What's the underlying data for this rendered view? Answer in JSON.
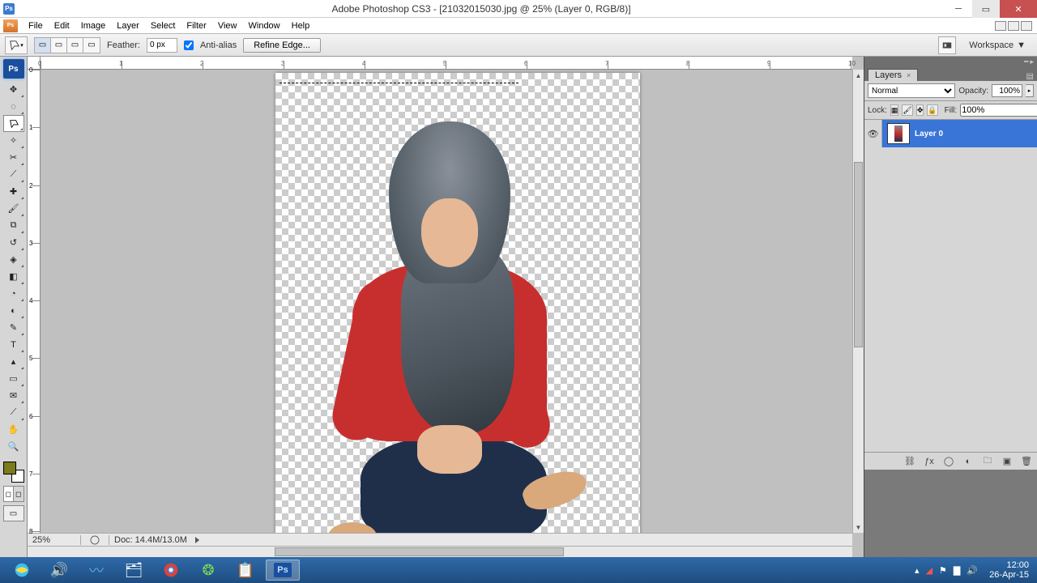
{
  "window": {
    "title": "Adobe Photoshop CS3 - [21032015030.jpg @ 25% (Layer 0, RGB/8)]",
    "app_badge": "Ps"
  },
  "menu": {
    "items": [
      "File",
      "Edit",
      "Image",
      "Layer",
      "Select",
      "Filter",
      "View",
      "Window",
      "Help"
    ]
  },
  "options": {
    "feather_label": "Feather:",
    "feather_value": "0 px",
    "antialias_label": "Anti-alias",
    "antialias_checked": true,
    "refine_label": "Refine Edge...",
    "workspace_label": "Workspace"
  },
  "ruler": {
    "h_numbers": [
      "0",
      "1",
      "2",
      "3",
      "4",
      "5",
      "6",
      "7",
      "8",
      "9",
      "10"
    ],
    "v_numbers": [
      "0",
      "1",
      "2",
      "3",
      "4",
      "5",
      "6",
      "7",
      "8"
    ]
  },
  "status": {
    "zoom": "25%",
    "doc_size": "Doc: 14.4M/13.0M"
  },
  "layers": {
    "tab_label": "Layers",
    "blend_mode": "Normal",
    "opacity_label": "Opacity:",
    "opacity_value": "100%",
    "lock_label": "Lock:",
    "fill_label": "Fill:",
    "fill_value": "100%",
    "items": [
      {
        "name": "Layer 0",
        "visible": true
      }
    ]
  },
  "taskbar": {
    "time": "12:00",
    "date": "26-Apr-15"
  },
  "tools": {
    "names": [
      "move-tool",
      "marquee-tool",
      "lasso-tool",
      "magic-wand-tool",
      "crop-tool",
      "slice-tool",
      "healing-brush-tool",
      "brush-tool",
      "clone-stamp-tool",
      "history-brush-tool",
      "eraser-tool",
      "gradient-tool",
      "blur-tool",
      "dodge-tool",
      "pen-tool",
      "type-tool",
      "path-selection-tool",
      "shape-tool",
      "notes-tool",
      "eyedropper-tool",
      "hand-tool",
      "zoom-tool"
    ]
  }
}
